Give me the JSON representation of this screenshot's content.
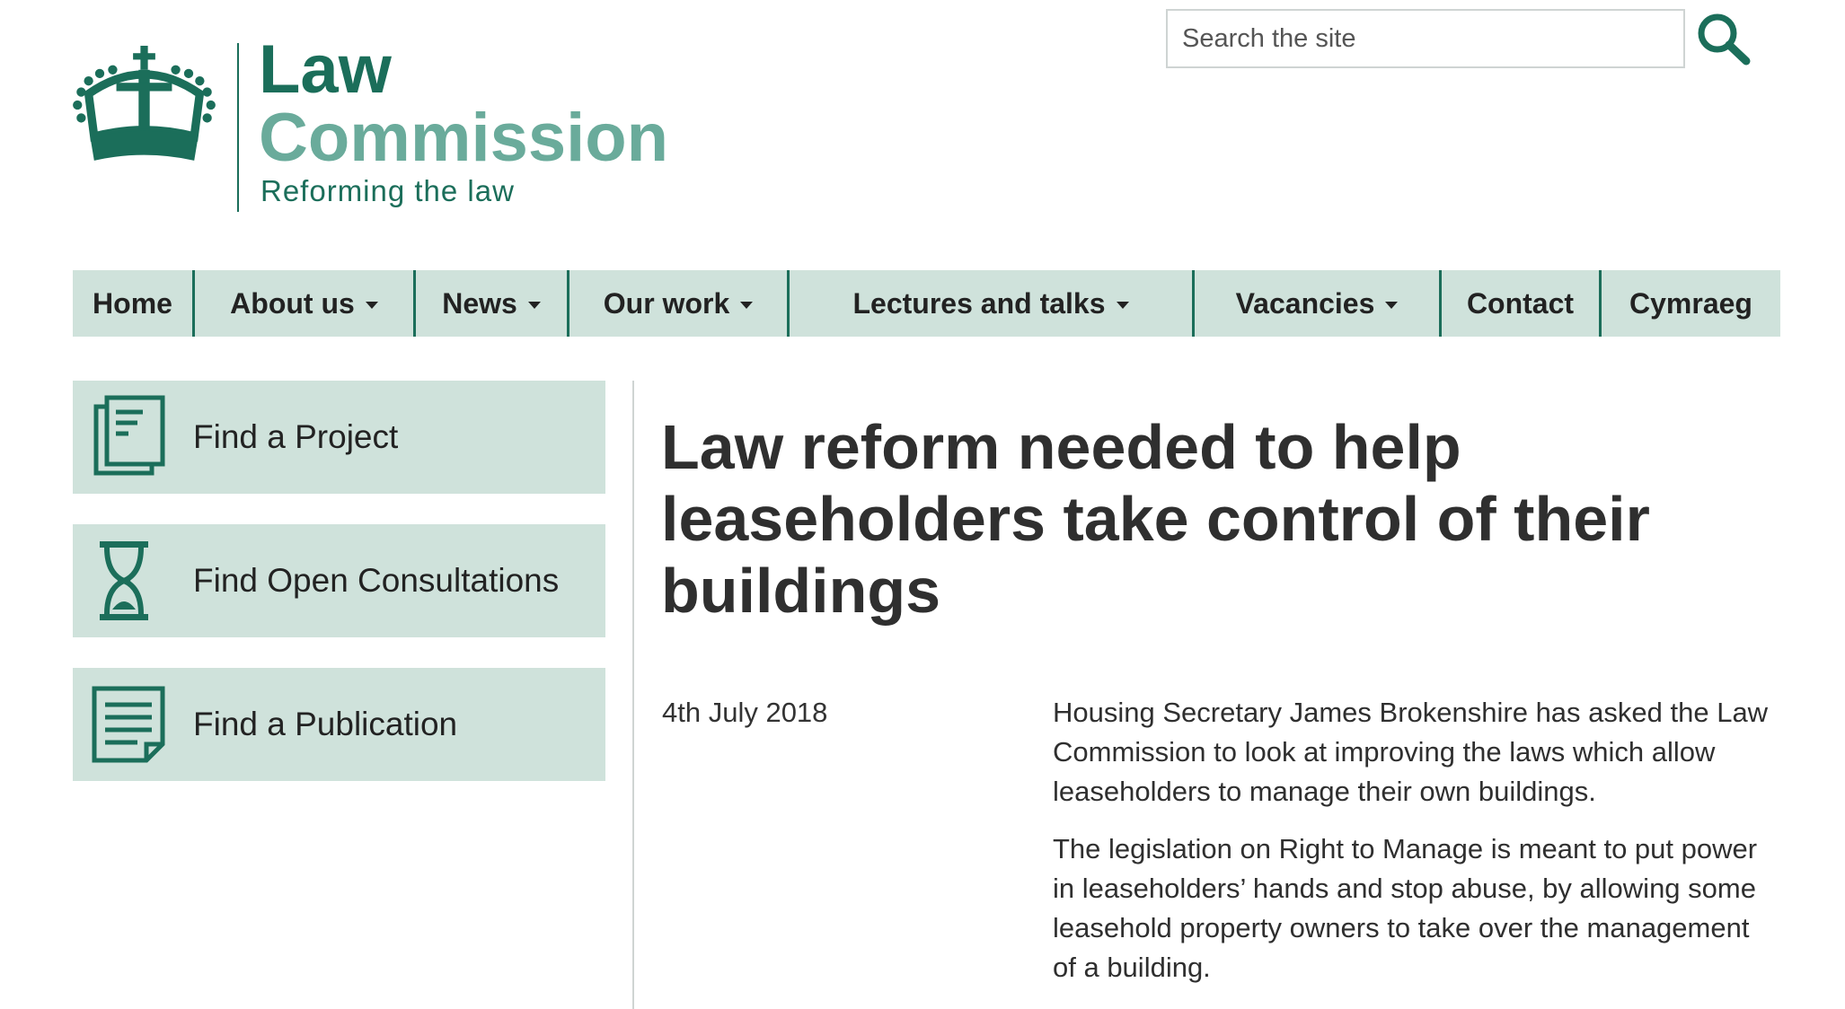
{
  "logo": {
    "line1": "Law",
    "line2": "Commission",
    "tagline": "Reforming the law"
  },
  "search": {
    "placeholder": "Search the site",
    "icon": "search-icon"
  },
  "nav": {
    "items": [
      {
        "label": "Home",
        "dropdown": false
      },
      {
        "label": "About us",
        "dropdown": true
      },
      {
        "label": "News",
        "dropdown": true
      },
      {
        "label": "Our work",
        "dropdown": true
      },
      {
        "label": "Lectures and talks",
        "dropdown": true
      },
      {
        "label": "Vacancies",
        "dropdown": true
      },
      {
        "label": "Contact",
        "dropdown": false
      },
      {
        "label": "Cymraeg",
        "dropdown": false
      }
    ]
  },
  "sidebar": {
    "items": [
      {
        "label": "Find a Project",
        "icon": "book-icon"
      },
      {
        "label": "Find Open Consultations",
        "icon": "hourglass-icon"
      },
      {
        "label": "Find a Publication",
        "icon": "document-icon"
      }
    ]
  },
  "article": {
    "title": "Law reform needed to help leaseholders take control of their buildings",
    "date": "4th July 2018",
    "paragraphs": [
      "Housing Secretary James Brokenshire has asked the Law Commission to look at improving the laws which allow leaseholders to manage their own buildings.",
      "The legislation on Right to Manage is meant to put power in leaseholders’ hands and stop abuse, by allowing some leasehold property owners to take over the management of a building."
    ]
  },
  "colors": {
    "brand_dark": "#1b6e5a",
    "brand_light": "#6aab9b",
    "nav_bg": "#cfe2db",
    "text": "#2f2f2f"
  }
}
